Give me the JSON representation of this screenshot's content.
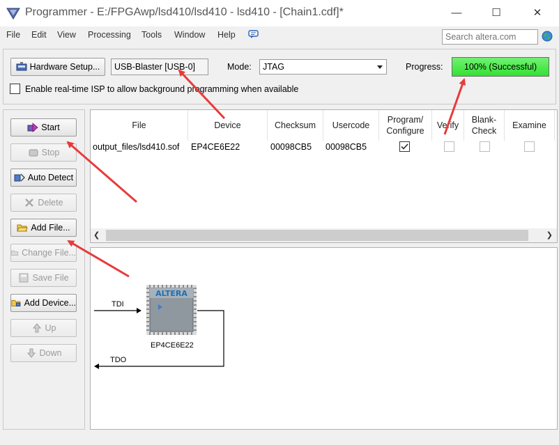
{
  "window": {
    "title": "Programmer - E:/FPGAwp/lsd410/lsd410 - lsd410 - [Chain1.cdf]*",
    "minimize": "—",
    "maximize": "☐",
    "close": "✕"
  },
  "menu": [
    "File",
    "Edit",
    "View",
    "Processing",
    "Tools",
    "Window",
    "Help"
  ],
  "search": {
    "placeholder": "Search altera.com"
  },
  "toolbar": {
    "hardware_setup": "Hardware Setup...",
    "hardware_value": "USB-Blaster [USB-0]",
    "mode_label": "Mode:",
    "mode_value": "JTAG",
    "progress_label": "Progress:",
    "progress_percent": 100,
    "progress_text": "100% (Successful)",
    "isp_label": "Enable real-time ISP to allow background programming when available",
    "isp_checked": false
  },
  "side_buttons": {
    "start": "Start",
    "stop": "Stop",
    "auto_detect": "Auto Detect",
    "delete": "Delete",
    "add_file": "Add File...",
    "change_file": "Change File...",
    "save_file": "Save File",
    "add_device": "Add Device...",
    "up": "Up",
    "down": "Down"
  },
  "table": {
    "columns": {
      "file": "File",
      "device": "Device",
      "checksum": "Checksum",
      "usercode": "Usercode",
      "program_line1": "Program/",
      "program_line2": "Configure",
      "verify": "Verify",
      "blank_line1": "Blank-",
      "blank_line2": "Check",
      "examine": "Examine"
    },
    "row": {
      "file": "output_files/lsd410.sof",
      "device": "EP4CE6E22",
      "checksum": "00098CB5",
      "usercode": "00098CB5",
      "program_configure": true,
      "verify": false,
      "blank_check": false,
      "examine": false
    }
  },
  "chain": {
    "tdi": "TDI",
    "tdo": "TDO",
    "chip_logo": "ALTERA",
    "device": "EP4CE6E22"
  },
  "colors": {
    "progress_fill": "#33e133",
    "annotation_arrow": "#e83a3a",
    "chip_logo": "#1f6fb5"
  }
}
